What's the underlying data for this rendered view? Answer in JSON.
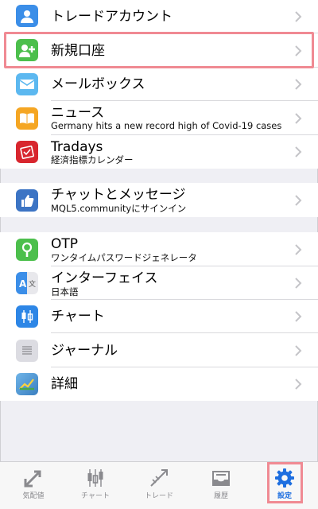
{
  "menu": {
    "items": [
      {
        "title": "トレードアカウント",
        "subtitle": "",
        "icon": "account-icon"
      },
      {
        "title": "新規口座",
        "subtitle": "",
        "icon": "add-user-icon"
      },
      {
        "title": "メールボックス",
        "subtitle": "",
        "icon": "mail-icon"
      },
      {
        "title": "ニュース",
        "subtitle": "Germany hits a new record high of Covid-19 cases",
        "icon": "news-icon"
      },
      {
        "title": "Tradays",
        "subtitle": "経済指標カレンダー",
        "icon": "tradays-icon"
      },
      {
        "title": "チャットとメッセージ",
        "subtitle": "MQL5.communityにサインイン",
        "icon": "chat-icon"
      },
      {
        "title": "OTP",
        "subtitle": "ワンタイムパスワードジェネレータ",
        "icon": "otp-icon"
      },
      {
        "title": "インターフェイス",
        "subtitle": "日本語",
        "icon": "language-icon"
      },
      {
        "title": "チャート",
        "subtitle": "",
        "icon": "chart-icon"
      },
      {
        "title": "ジャーナル",
        "subtitle": "",
        "icon": "journal-icon"
      },
      {
        "title": "詳細",
        "subtitle": "",
        "icon": "about-icon"
      }
    ]
  },
  "tabbar": {
    "tabs": [
      {
        "label": "気配値",
        "icon": "quotes-icon"
      },
      {
        "label": "チャート",
        "icon": "chart-tab-icon"
      },
      {
        "label": "トレード",
        "icon": "trade-tab-icon"
      },
      {
        "label": "履歴",
        "icon": "history-icon"
      },
      {
        "label": "設定",
        "icon": "settings-icon",
        "active": true
      }
    ]
  },
  "colors": {
    "accent": "#1e6fe0",
    "highlight": "#f08a93",
    "background": "#efeff4"
  }
}
